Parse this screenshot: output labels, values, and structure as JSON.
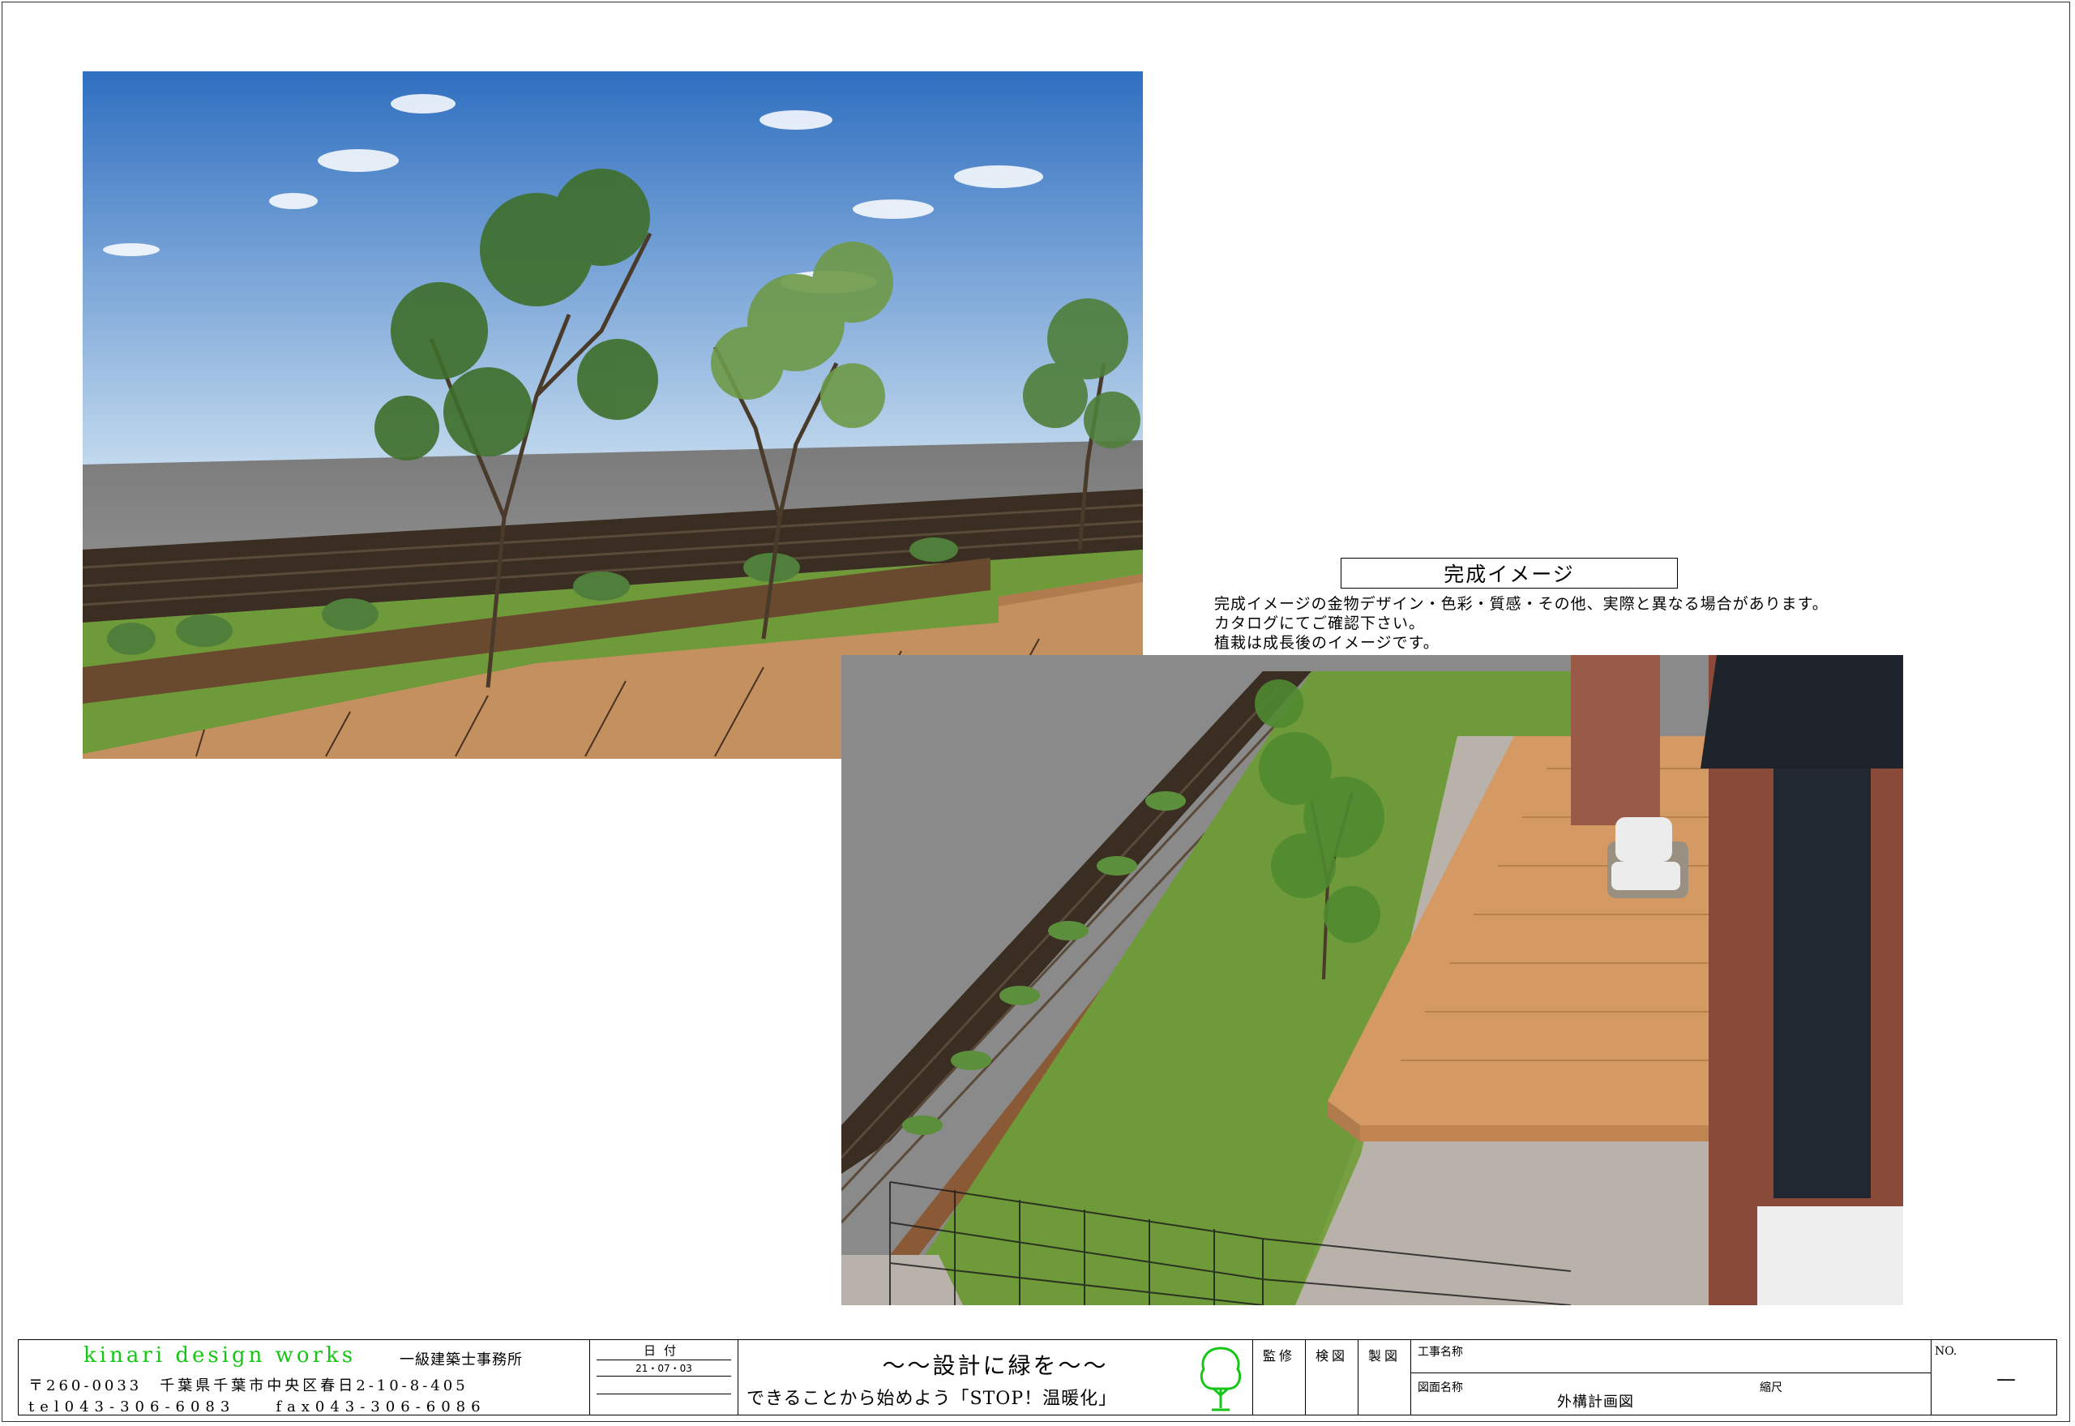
{
  "caption": {
    "title": "完成イメージ",
    "notes": [
      "完成イメージの金物デザイン・色彩・質感・その他、実際と異なる場合があります。",
      "カタログにてご確認下さい。",
      "植栽は成長後のイメージです。"
    ]
  },
  "titleblock": {
    "company_name": "kinari design works",
    "company_type": "一級建築士事務所",
    "address": "〒260-0033　千葉県千葉市中央区春日2-10-8-405",
    "tel_fax": "tel043-306-6083　　fax043-306-6086",
    "date_label": "日付",
    "date_value": "21・07・03",
    "slogan_main": "～～設計に緑を～～",
    "slogan_sub": "できることから始めよう「STOP！温暖化」",
    "stamp_supervision": "監修",
    "stamp_check": "検図",
    "stamp_draft": "製図",
    "project_name_label": "工事名称",
    "drawing_name_label": "図面名称",
    "drawing_name": "外構計画図",
    "scale_label": "縮尺",
    "no_label": "NO.",
    "no_value": "—"
  },
  "colors": {
    "company_green": "#16c616",
    "deck": "#c49060",
    "lawn": "#6f9a3a",
    "fence": "#3a2e22",
    "sky": "#4f8fd0"
  }
}
